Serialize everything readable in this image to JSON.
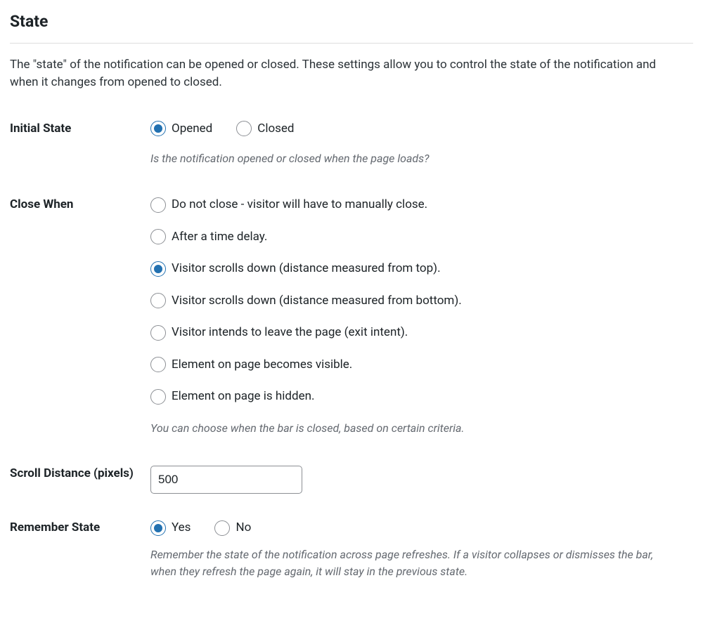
{
  "section": {
    "title": "State",
    "description": "The \"state\" of the notification can be opened or closed. These settings allow you to control the state of the notification and when it changes from opened to closed."
  },
  "initial_state": {
    "label": "Initial State",
    "options": {
      "opened": "Opened",
      "closed": "Closed"
    },
    "helper": "Is the notification opened or closed when the page loads?"
  },
  "close_when": {
    "label": "Close When",
    "options": [
      "Do not close - visitor will have to manually close.",
      "After a time delay.",
      "Visitor scrolls down (distance measured from top).",
      "Visitor scrolls down (distance measured from bottom).",
      "Visitor intends to leave the page (exit intent).",
      "Element on page becomes visible.",
      "Element on page is hidden."
    ],
    "helper": "You can choose when the bar is closed, based on certain criteria."
  },
  "scroll_distance": {
    "label": "Scroll Distance (pixels)",
    "value": "500"
  },
  "remember_state": {
    "label": "Remember State",
    "options": {
      "yes": "Yes",
      "no": "No"
    },
    "helper": "Remember the state of the notification across page refreshes. If a visitor collapses or dismisses the bar, when they refresh the page again, it will stay in the previous state."
  }
}
